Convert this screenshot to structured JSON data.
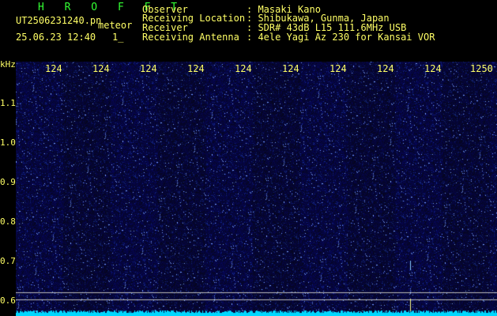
{
  "header": {
    "brand": "H R O F F T",
    "filename": "UT2506231240.pn",
    "mode": "meteor",
    "datetime": "25.06.23 12:40",
    "counter": "1_",
    "labels": [
      "Observer",
      "Receiving Location",
      "Receiver",
      "Receiving Antenna"
    ],
    "values": [
      ": Masaki Kano",
      ": Shibukawa, Gunma, Japan",
      ": SDR# 43dB L15 111.6MHz USB",
      ": 4ele Yagi Az 230 for Kansai VOR"
    ]
  },
  "axis": {
    "y_unit": "kHz",
    "y_ticks": [
      "1.1",
      "1.0",
      "0.9",
      "0.8",
      "0.7",
      "0.6"
    ],
    "x_ticks": [
      "124",
      "124",
      "124",
      "124",
      "124",
      "124",
      "124",
      "124",
      "124",
      "1250"
    ]
  },
  "colors": {
    "background": "#05053a",
    "text": "#ffff66",
    "brand": "#33ff33",
    "noise": "#00d8ff"
  }
}
